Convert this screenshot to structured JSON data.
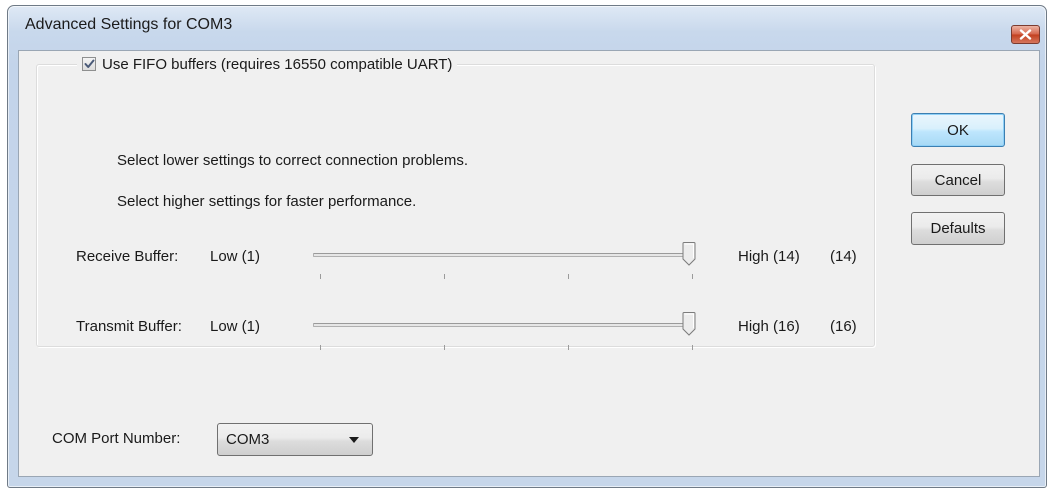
{
  "window": {
    "title": "Advanced Settings for COM3"
  },
  "fifo": {
    "checkbox_label": "Use FIFO buffers (requires 16550 compatible UART)",
    "checked": true,
    "hint_lower": "Select lower settings to correct connection problems.",
    "hint_higher": "Select higher settings for faster performance."
  },
  "receive_buffer": {
    "label": "Receive Buffer:",
    "low_label": "Low (1)",
    "high_label": "High (14)",
    "current": "(14)",
    "min": 1,
    "max": 14,
    "value": 14
  },
  "transmit_buffer": {
    "label": "Transmit Buffer:",
    "low_label": "Low (1)",
    "high_label": "High (16)",
    "current": "(16)",
    "min": 1,
    "max": 16,
    "value": 16
  },
  "buttons": {
    "ok": "OK",
    "cancel": "Cancel",
    "defaults": "Defaults"
  },
  "com_port": {
    "label": "COM Port Number:",
    "value": "COM3"
  },
  "colors": {
    "titlebar": "#c8d8ec",
    "client_background": "#f0f0f0",
    "close_button": "#c3401f",
    "default_button_border": "#3c7fb1"
  },
  "icons": {
    "close": "close-icon",
    "checkmark": "checkmark-icon",
    "dropdown": "chevron-down-icon"
  }
}
